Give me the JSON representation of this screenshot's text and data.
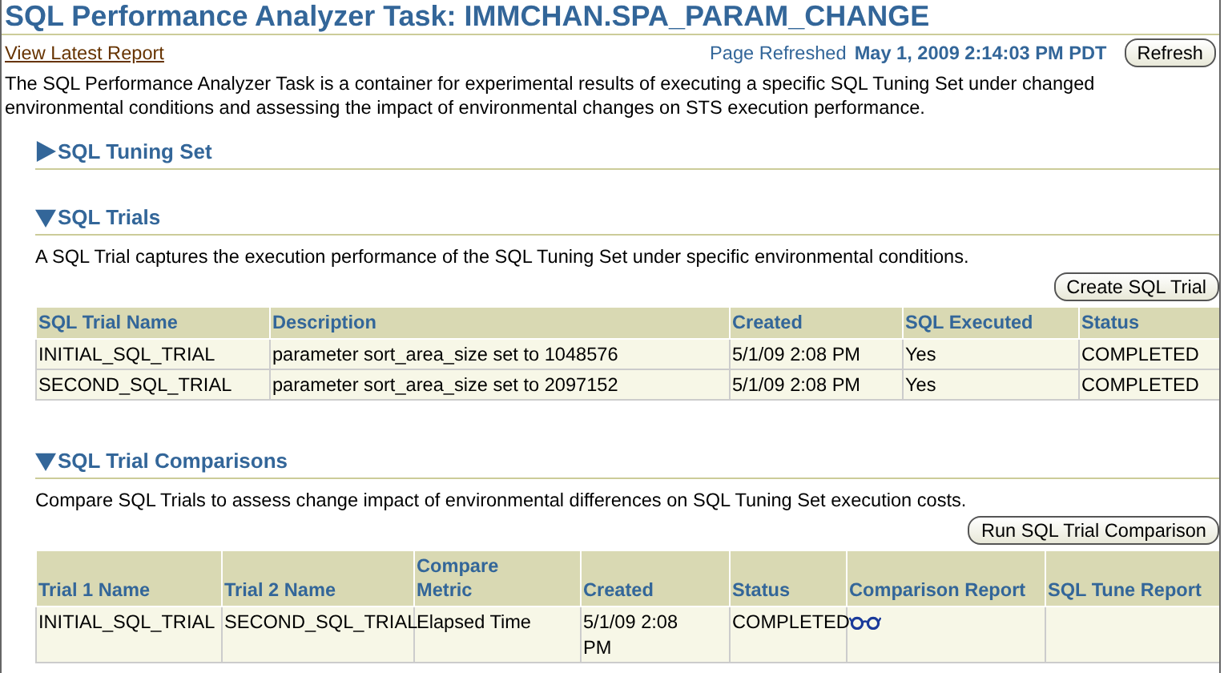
{
  "page_title": "SQL Performance Analyzer Task: IMMCHAN.SPA_PARAM_CHANGE",
  "report_link": "View Latest Report",
  "refresh": {
    "label": "Page Refreshed",
    "time": "May 1, 2009 2:14:03 PM PDT",
    "button": "Refresh"
  },
  "intro": "The SQL Performance Analyzer Task is a container for experimental results of executing a specific SQL Tuning Set under changed environmental conditions and assessing the impact of environmental changes on STS execution performance.",
  "sections": [
    {
      "title": "SQL Tuning Set",
      "expanded": false
    },
    {
      "title": "SQL Trials",
      "expanded": true,
      "description": "A SQL Trial captures the execution performance of the SQL Tuning Set under specific environmental conditions.",
      "button": "Create SQL Trial",
      "table": {
        "columns": [
          "SQL Trial Name",
          "Description",
          "Created",
          "SQL Executed",
          "Status"
        ],
        "rows": [
          [
            {
              "kind": "text",
              "text": "INITIAL_SQL_TRIAL"
            },
            {
              "kind": "text",
              "text": "parameter sort_area_size set to 1048576"
            },
            {
              "kind": "text",
              "text": "5/1/09 2:08 PM"
            },
            {
              "kind": "text",
              "text": "Yes"
            },
            {
              "kind": "text",
              "text": "COMPLETED"
            }
          ],
          [
            {
              "kind": "text",
              "text": "SECOND_SQL_TRIAL"
            },
            {
              "kind": "text",
              "text": "parameter sort_area_size set to 2097152"
            },
            {
              "kind": "text",
              "text": "5/1/09 2:08 PM"
            },
            {
              "kind": "text",
              "text": "Yes"
            },
            {
              "kind": "text",
              "text": "COMPLETED"
            }
          ]
        ]
      }
    },
    {
      "title": "SQL Trial Comparisons",
      "expanded": true,
      "description": "Compare SQL Trials to assess change impact of environmental differences on SQL Tuning Set execution costs.",
      "button": "Run SQL Trial Comparison",
      "table": {
        "columns": [
          "Trial 1 Name",
          "Trial 2 Name",
          "Compare Metric",
          "Created",
          "Status",
          "Comparison Report",
          "SQL Tune Report"
        ],
        "rows": [
          [
            {
              "kind": "text",
              "text": "INITIAL_SQL_TRIAL"
            },
            {
              "kind": "text",
              "text": "SECOND_SQL_TRIAL"
            },
            {
              "kind": "text",
              "text": "Elapsed Time"
            },
            {
              "kind": "text",
              "text": "5/1/09 2:08 PM"
            },
            {
              "kind": "text",
              "text": "COMPLETED"
            },
            {
              "kind": "icon"
            },
            {
              "kind": "empty"
            }
          ]
        ]
      }
    }
  ]
}
